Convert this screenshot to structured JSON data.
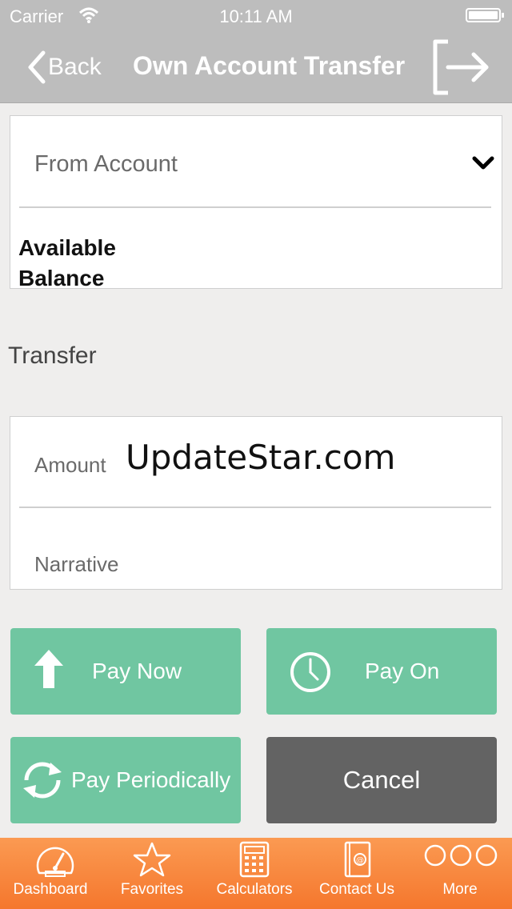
{
  "status_bar": {
    "carrier": "Carrier",
    "time": "10:11 AM"
  },
  "nav": {
    "back_label": "Back",
    "title": "Own Account Transfer"
  },
  "from_account": {
    "label": "From Account",
    "available_balance_label": "Available Balance"
  },
  "transfer_section": {
    "label": "Transfer"
  },
  "transfer_form": {
    "amount_label": "Amount",
    "amount_value": "UpdateStar.com",
    "narrative_placeholder": "Narrative"
  },
  "actions": {
    "pay_now": "Pay Now",
    "pay_on": "Pay On",
    "pay_periodically": "Pay Periodically",
    "cancel": "Cancel"
  },
  "tabs": [
    {
      "label": "Dashboard",
      "icon": "dashboard-icon"
    },
    {
      "label": "Favorites",
      "icon": "star-icon"
    },
    {
      "label": "Calculators",
      "icon": "calculator-icon"
    },
    {
      "label": "Contact Us",
      "icon": "contact-book-icon"
    },
    {
      "label": "More",
      "icon": "more-icon"
    }
  ],
  "colors": {
    "header": "#bdbdbd",
    "action_green": "#70c6a1",
    "cancel_gray": "#636363",
    "tabbar_orange": "#f5772d",
    "background": "#efeeed"
  }
}
